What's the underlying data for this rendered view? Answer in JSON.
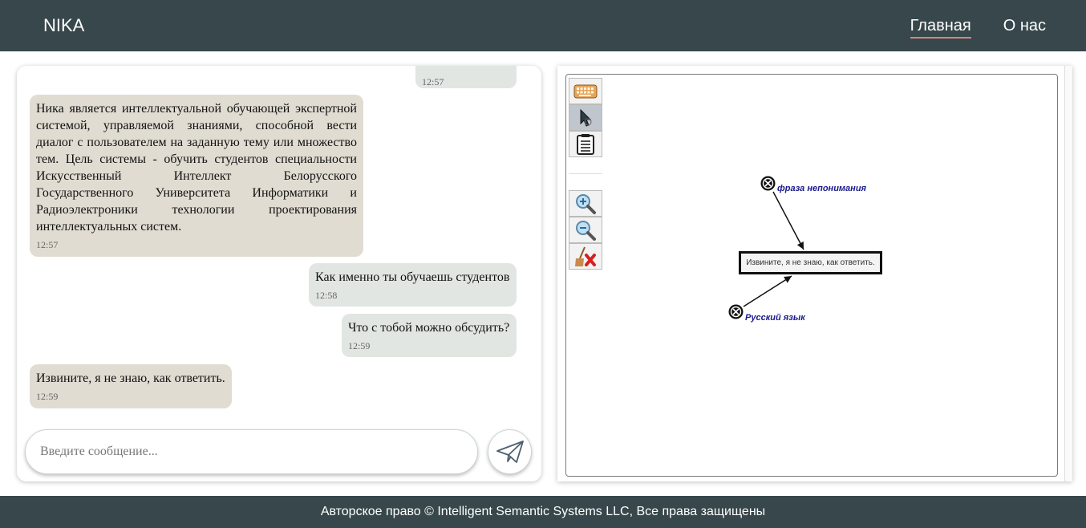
{
  "header": {
    "brand": "NIKA",
    "nav": [
      {
        "label": "Главная",
        "active": true
      },
      {
        "label": "О нас",
        "active": false
      }
    ]
  },
  "chat": {
    "messages": [
      {
        "from": "user",
        "text": "",
        "time": "12:57"
      },
      {
        "from": "bot",
        "text": "Ника является интеллектуальной обучающей экспертной системой, управляемой знаниями, способной вести диалог с пользователем на заданную тему или множество тем. Цель системы - обучить студентов специальности Искусственный Интеллект Белорусского Государственного Университета Информатики и Радиоэлектроники технологии проектирования интеллектуальных систем.",
        "time": "12:57"
      },
      {
        "from": "user",
        "text": "Как именно ты обучаешь студентов",
        "time": "12:58"
      },
      {
        "from": "user",
        "text": "Что с тобой можно обсудить?",
        "time": "12:59"
      },
      {
        "from": "bot",
        "text": "Извините, я не знаю, как ответить.",
        "time": "12:59"
      }
    ],
    "input": {
      "placeholder": "Введите сообщение...",
      "value": ""
    },
    "send_icon": "paper-plane-icon"
  },
  "graph": {
    "tools": [
      {
        "name": "keyboard-icon"
      },
      {
        "name": "pointer-icon"
      },
      {
        "name": "document-icon"
      },
      {
        "name": "zoom-in-icon"
      },
      {
        "name": "zoom-out-icon"
      },
      {
        "name": "clear-icon"
      }
    ],
    "nodes": {
      "top_label": "фраза непонимания",
      "center_text": "Извините, я не знаю, как ответить.",
      "bottom_label": "Русский язык"
    }
  },
  "footer": {
    "text": "Авторское право © Intelligent Semantic Systems LLC, Все права защищены"
  },
  "colors": {
    "header_bg": "#37474b",
    "bot_bubble": "#e1dcd2",
    "user_bubble": "#e1e6e3",
    "nav_underline": "#d4867c",
    "node_label": "#1a1a8c"
  }
}
